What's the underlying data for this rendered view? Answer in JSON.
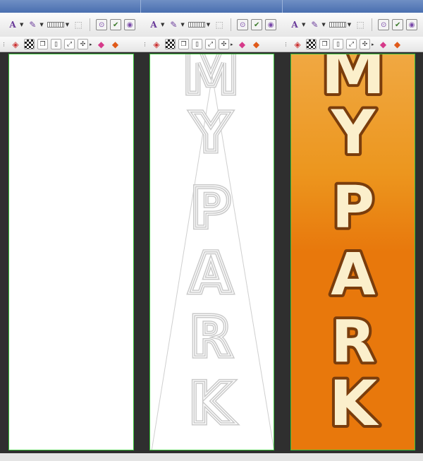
{
  "toolbar": {
    "text_tool_glyph": "A",
    "zoom_icon": "zoom-icon",
    "check_icon": "check-icon",
    "target_icon": "target-icon"
  },
  "artwork": {
    "letters": [
      "M",
      "Y",
      "P",
      "A",
      "R",
      "K"
    ],
    "fill_color": "#fbefcb",
    "stroke_color": "#7a3d0c",
    "gradient_top": "#f0a842",
    "gradient_bottom": "#e8780c"
  }
}
